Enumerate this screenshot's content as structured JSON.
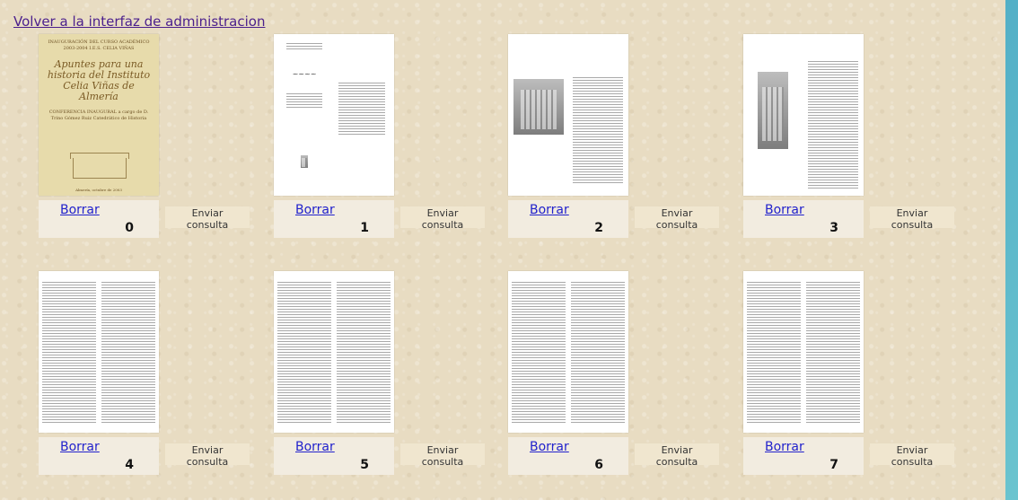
{
  "header": {
    "back_link": "Volver a la interfaz de administracion"
  },
  "cover": {
    "top": "INAUGURACIÓN DEL CURSO ACADÉMICO 2003-2004  I.E.S. CELIA VIÑAS",
    "title": "Apuntes para una historia del Instituto Celia Viñas de Almería",
    "sub": "CONFERENCIA INAUGURAL a cargo de D. Trino Gómez Ruiz Catedrático de Historia",
    "bottom": "Almería, octubre de 2003"
  },
  "pages": [
    {
      "number": "0",
      "delete_label": "Borrar",
      "query_label": "Enviar consulta"
    },
    {
      "number": "1",
      "delete_label": "Borrar",
      "query_label": "Enviar consulta"
    },
    {
      "number": "2",
      "delete_label": "Borrar",
      "query_label": "Enviar consulta"
    },
    {
      "number": "3",
      "delete_label": "Borrar",
      "query_label": "Enviar consulta"
    },
    {
      "number": "4",
      "delete_label": "Borrar",
      "query_label": "Enviar consulta"
    },
    {
      "number": "5",
      "delete_label": "Borrar",
      "query_label": "Enviar consulta"
    },
    {
      "number": "6",
      "delete_label": "Borrar",
      "query_label": "Enviar consulta"
    },
    {
      "number": "7",
      "delete_label": "Borrar",
      "query_label": "Enviar consulta"
    }
  ]
}
